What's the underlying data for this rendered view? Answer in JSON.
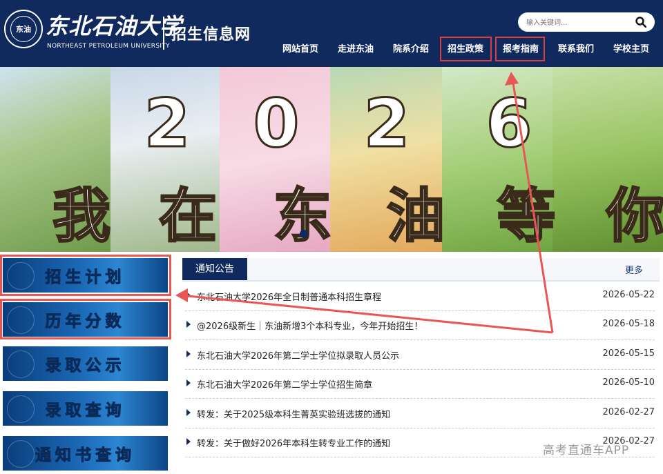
{
  "header": {
    "seal_text": "东油",
    "logo_cn": "东北石油大学",
    "logo_en": "NORTHEAST PETROLEUM UNIVERSITY",
    "site_title": "招生信息网",
    "search_placeholder": "输入关键词...",
    "nav": [
      "网站首页",
      "走进东油",
      "院系介绍",
      "招生政策",
      "报考指南",
      "联系我们",
      "学校主页"
    ],
    "highlighted_nav": [
      "招生政策",
      "报考指南"
    ]
  },
  "banner": {
    "digits": [
      "2",
      "0",
      "2",
      "6"
    ],
    "slogan": [
      "我",
      "在",
      "东",
      "油",
      "等",
      "你"
    ]
  },
  "left_buttons": [
    "招生计划",
    "历年分数",
    "录取公示",
    "录取查询",
    "通知书查询"
  ],
  "notice": {
    "tab_label": "通知公告",
    "more_label": "更多",
    "items": [
      {
        "title": "东北石油大学2026年全日制普通本科招生章程",
        "date": "2026-05-22"
      },
      {
        "title": "@2026级新生｜东油新增3个本科专业，今年开始招生！",
        "date": "2026-05-18"
      },
      {
        "title": "东北石油大学2026年第二学士学位拟录取人员公示",
        "date": "2026-05-15"
      },
      {
        "title": "东北石油大学2026年第二学士学位招生简章",
        "date": "2026-05-10"
      },
      {
        "title": "转发：关于2025级本科生菁英实验班选拔的通知",
        "date": "2026-02-27"
      },
      {
        "title": "转发：关于做好2026年本科生转专业工作的通知",
        "date": "2026-02-27"
      }
    ]
  },
  "watermark": "高考直通车APP",
  "colors": {
    "header_bg": "#102a5e",
    "highlight": "#e03c3c",
    "button_blue": "#1a67b4"
  }
}
